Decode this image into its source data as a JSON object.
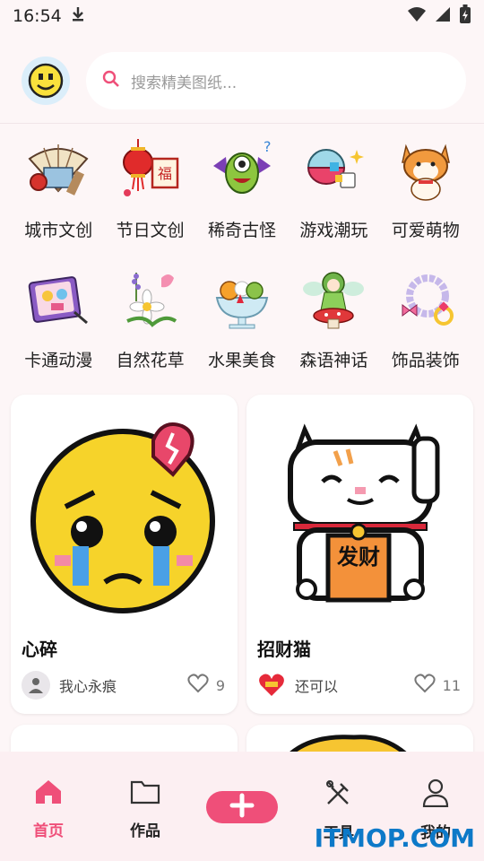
{
  "status_bar": {
    "time": "16:54"
  },
  "search": {
    "placeholder": "搜索精美图纸..."
  },
  "categories": [
    {
      "label": "城市文创",
      "icon": "folding-fan-icon"
    },
    {
      "label": "节日文创",
      "icon": "lantern-icon"
    },
    {
      "label": "稀奇古怪",
      "icon": "monster-icon"
    },
    {
      "label": "游戏潮玩",
      "icon": "gacha-icon"
    },
    {
      "label": "可爱萌物",
      "icon": "shiba-icon"
    },
    {
      "label": "卡通动漫",
      "icon": "cartoon-book-icon"
    },
    {
      "label": "自然花草",
      "icon": "flower-icon"
    },
    {
      "label": "水果美食",
      "icon": "fruit-parfait-icon"
    },
    {
      "label": "森语神话",
      "icon": "fairy-icon"
    },
    {
      "label": "饰品装饰",
      "icon": "bracelet-icon"
    }
  ],
  "cards": [
    {
      "title": "心碎",
      "author": "我心永痕",
      "likes": "9",
      "art": "crying-emoji-heartbreak"
    },
    {
      "title": "招财猫",
      "author": "还可以",
      "likes": "11",
      "art": "lucky-cat",
      "art_text": "发财"
    }
  ],
  "nav": {
    "home": "首页",
    "works": "作品",
    "tools": "工具",
    "mine": "我的"
  },
  "watermark": "ITMOP.COM",
  "colors": {
    "accent": "#ef4f79",
    "background": "#fdf6f7"
  }
}
